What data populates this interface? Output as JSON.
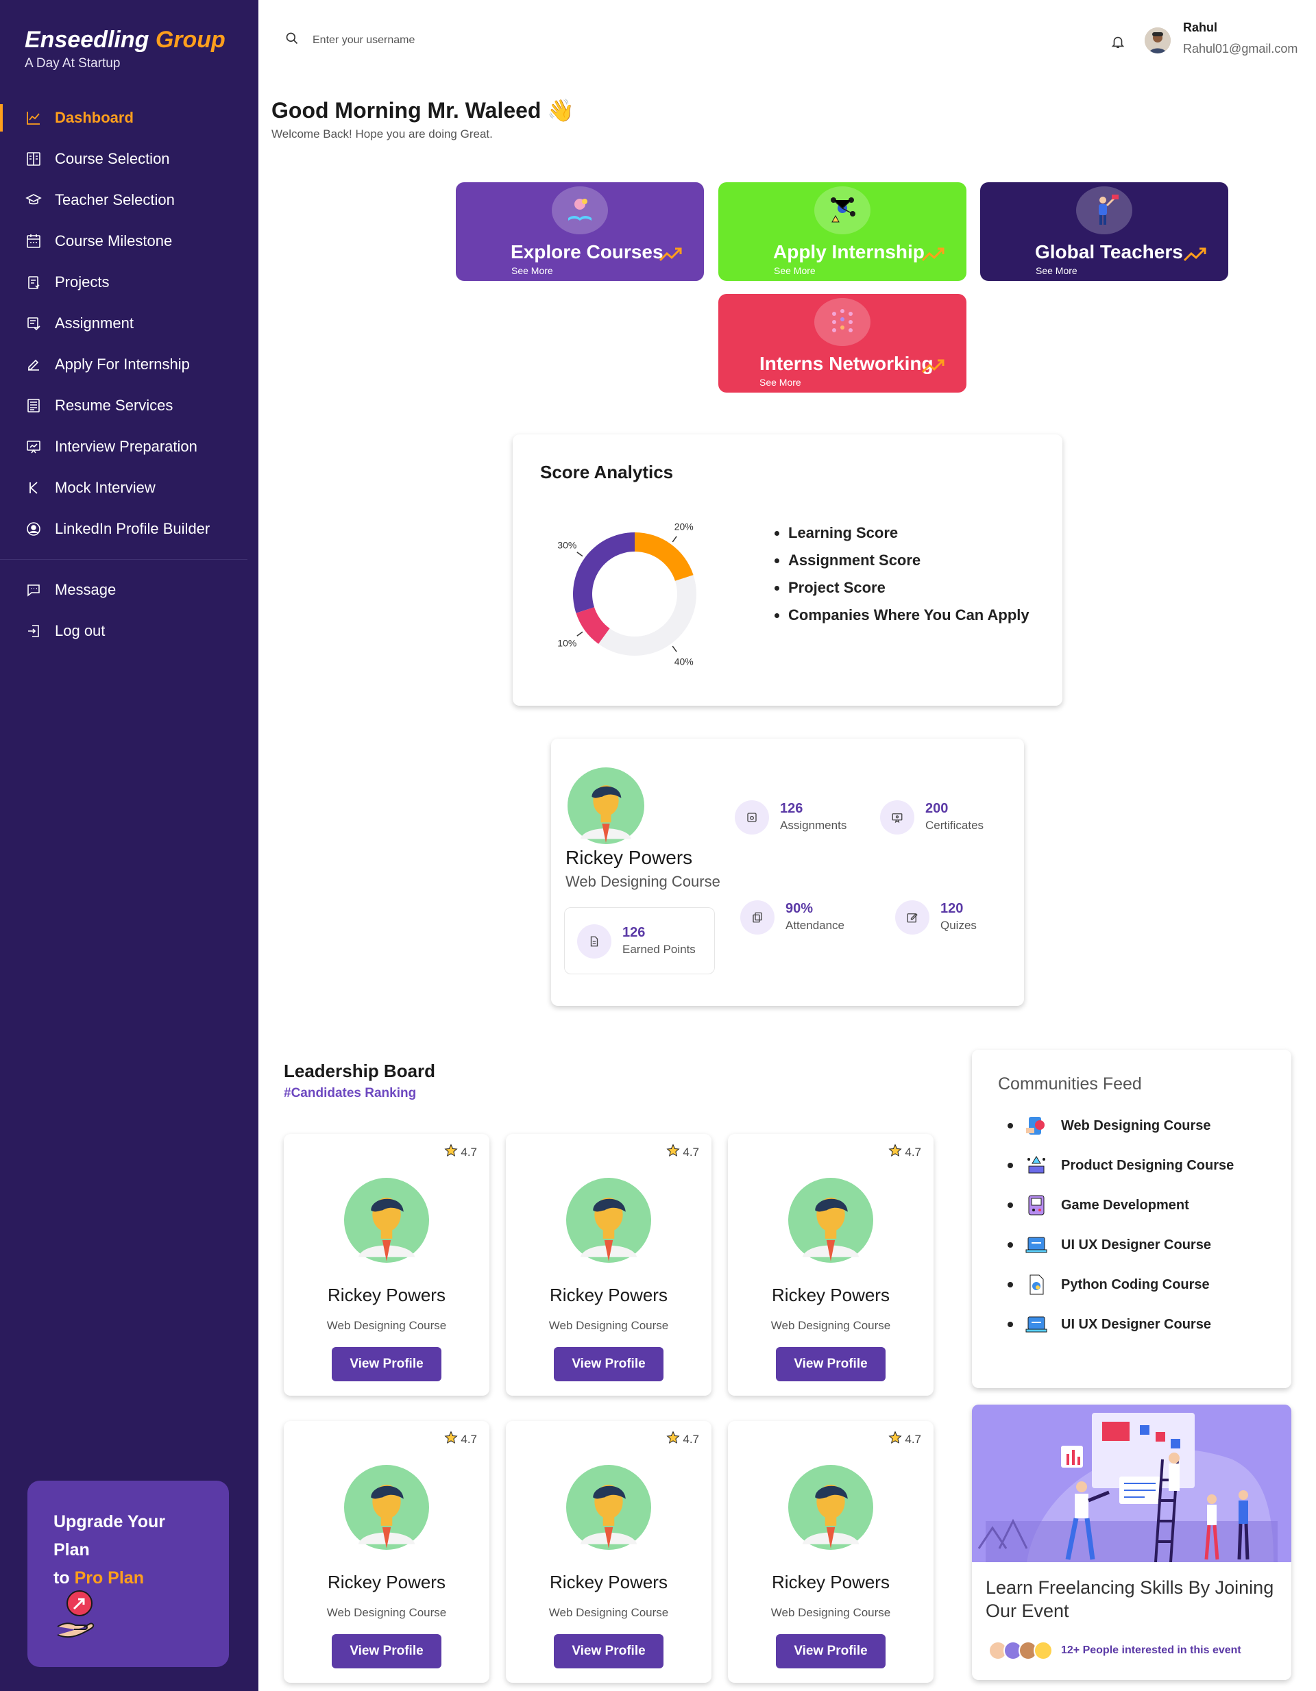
{
  "brand": {
    "name_main": "Enseedling",
    "name_accent": "Group",
    "tagline": "A Day At Startup"
  },
  "nav": {
    "items": [
      {
        "label": "Dashboard",
        "icon": "chart-line-icon"
      },
      {
        "label": "Course Selection",
        "icon": "book-icon"
      },
      {
        "label": "Teacher Selection",
        "icon": "graduation-cap-icon"
      },
      {
        "label": "Course Milestone",
        "icon": "calendar-icon"
      },
      {
        "label": "Projects",
        "icon": "clipboard-icon"
      },
      {
        "label": "Assignment",
        "icon": "assignment-icon"
      },
      {
        "label": "Apply For Internship",
        "icon": "edit-icon"
      },
      {
        "label": "Resume Services",
        "icon": "document-icon"
      },
      {
        "label": "Interview Preparation",
        "icon": "presentation-icon"
      },
      {
        "label": "Mock Interview",
        "icon": "k-icon"
      },
      {
        "label": "LinkedIn Profile Builder",
        "icon": "user-circle-icon"
      }
    ],
    "secondary": [
      {
        "label": "Message",
        "icon": "message-icon"
      },
      {
        "label": "Log out",
        "icon": "logout-icon"
      }
    ]
  },
  "upgrade": {
    "line1": "Upgrade Your Plan",
    "line2_prefix": "to",
    "line2_accent": "Pro Plan"
  },
  "header": {
    "search_placeholder": "Enter your username",
    "user_name": "Rahul",
    "user_email": "Rahul01@gmail.com"
  },
  "greeting": {
    "title": "Good Morning Mr. Waleed 👋",
    "subtitle": "Welcome Back! Hope you are doing Great."
  },
  "tiles": [
    {
      "title": "Explore Courses",
      "more": "See More",
      "color": "#6b3fae"
    },
    {
      "title": "Apply Internship",
      "more": "See More",
      "color": "#6be82a"
    },
    {
      "title": "Global Teachers",
      "more": "See More",
      "color": "#2e1a63"
    },
    {
      "title": "Interns Networking",
      "more": "See More",
      "color": "#ea3a57"
    }
  ],
  "score": {
    "title": "Score Analytics",
    "items": [
      "Learning Score",
      "Assignment Score",
      "Project Score",
      "Companies Where You Can Apply"
    ],
    "chart_data": {
      "type": "pie",
      "labels": [
        "20%",
        "40%",
        "10%",
        "30%"
      ],
      "values": [
        20,
        40,
        10,
        30
      ],
      "colors": [
        "#ff9800",
        "#f1f1f4",
        "#ea3a6a",
        "#5b3aa6"
      ]
    }
  },
  "profile": {
    "name": "Rickey Powers",
    "course": "Web Designing Course",
    "earned_points": "126",
    "earned_label": "Earned Points",
    "stats": [
      {
        "num": "126",
        "label": "Assignments"
      },
      {
        "num": "200",
        "label": "Certificates"
      },
      {
        "num": "90%",
        "label": "Attendance"
      },
      {
        "num": "120",
        "label": "Quizes"
      }
    ]
  },
  "leaderboard": {
    "title": "Leadership Board",
    "subtitle": "#Candidates Ranking",
    "button_label": "View Profile",
    "cards": [
      {
        "rating": "4.7",
        "name": "Rickey Powers",
        "course": "Web Designing Course"
      },
      {
        "rating": "4.7",
        "name": "Rickey Powers",
        "course": "Web Designing Course"
      },
      {
        "rating": "4.7",
        "name": "Rickey Powers",
        "course": "Web Designing Course"
      },
      {
        "rating": "4.7",
        "name": "Rickey Powers",
        "course": "Web Designing Course"
      },
      {
        "rating": "4.7",
        "name": "Rickey Powers",
        "course": "Web Designing Course"
      },
      {
        "rating": "4.7",
        "name": "Rickey Powers",
        "course": "Web Designing Course"
      }
    ]
  },
  "communities": {
    "title": "Communities Feed",
    "items": [
      "Web Designing Course",
      "Product Designing Course",
      "Game Development",
      "UI UX Designer Course",
      "Python Coding Course",
      "UI UX Designer Course"
    ]
  },
  "event": {
    "title": "Learn Freelancing Skills By Joining Our Event",
    "interested": "12+ People interested in this event"
  }
}
